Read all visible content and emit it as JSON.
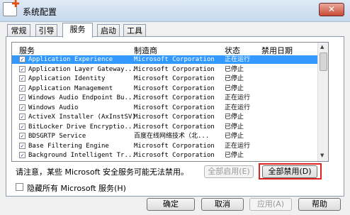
{
  "window": {
    "title": "系统配置",
    "close_label": "✕"
  },
  "tabs": [
    {
      "label": "常规"
    },
    {
      "label": "引导"
    },
    {
      "label": "服务"
    },
    {
      "label": "启动"
    },
    {
      "label": "工具"
    }
  ],
  "active_tab": "服务",
  "table": {
    "headers": {
      "name": "服务",
      "manufacturer": "制造商",
      "status": "状态",
      "disabled_date": "禁用日期"
    },
    "rows": [
      {
        "checked": true,
        "name": "Application Experience",
        "manufacturer": "Microsoft Corporation",
        "status": "正在运行",
        "selected": true
      },
      {
        "checked": true,
        "name": "Application Layer Gateway...",
        "manufacturer": "Microsoft Corporation",
        "status": "已停止"
      },
      {
        "checked": true,
        "name": "Application Identity",
        "manufacturer": "Microsoft Corporation",
        "status": "已停止"
      },
      {
        "checked": true,
        "name": "Application Management",
        "manufacturer": "Microsoft Corporation",
        "status": "已停止"
      },
      {
        "checked": true,
        "name": "Windows Audio Endpoint Bu...",
        "manufacturer": "Microsoft Corporation",
        "status": "正在运行"
      },
      {
        "checked": true,
        "name": "Windows Audio",
        "manufacturer": "Microsoft Corporation",
        "status": "正在运行"
      },
      {
        "checked": true,
        "name": "ActiveX Installer (AxInstSV)",
        "manufacturer": "Microsoft Corporation",
        "status": "已停止"
      },
      {
        "checked": true,
        "name": "BitLocker Drive Encryptio...",
        "manufacturer": "Microsoft Corporation",
        "status": "已停止"
      },
      {
        "checked": true,
        "name": "BDSGRTP Service",
        "manufacturer": "百度在线网络技术（北...",
        "status": "已停止"
      },
      {
        "checked": true,
        "name": "Base Filtering Engine",
        "manufacturer": "Microsoft Corporation",
        "status": "正在运行"
      },
      {
        "checked": true,
        "name": "Background Intelligent Tr...",
        "manufacturer": "Microsoft Corporation",
        "status": "已停止"
      }
    ]
  },
  "note": "请注意，某些 Microsoft 安全服务可能无法禁用。",
  "buttons": {
    "enable_all": "全部启用(E)",
    "disable_all": "全部禁用(D)",
    "ok": "确定",
    "cancel": "取消",
    "apply": "应用(A)",
    "help": "帮助"
  },
  "hide_ms_label": "隐藏所有 Microsoft 服务(H)"
}
